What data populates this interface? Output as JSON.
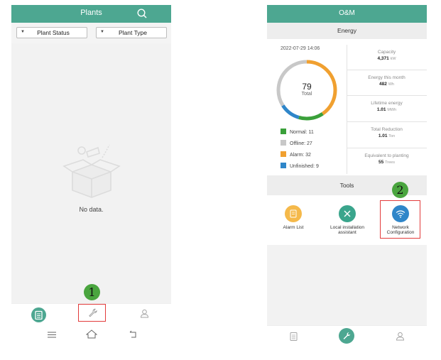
{
  "left_screen": {
    "header": {
      "title": "Plants"
    },
    "filters": {
      "plant_status": "Plant Status",
      "plant_type": "Plant Type"
    },
    "empty_state": {
      "message": "No data."
    },
    "marker": "1"
  },
  "right_screen": {
    "header": {
      "title": "O&M"
    },
    "energy": {
      "section_title": "Energy",
      "timestamp": "2022-07-29 14:06",
      "total_value": "79",
      "total_label": "Total",
      "legend": [
        {
          "label": "Normal: 11",
          "color": "#3aa03a"
        },
        {
          "label": "Offline: 27",
          "color": "#c8c8c8"
        },
        {
          "label": "Alarm: 32",
          "color": "#f0a030"
        },
        {
          "label": "Unfinished: 9",
          "color": "#2f86c9"
        }
      ],
      "stats": [
        {
          "label": "Capacity",
          "value": "4,371",
          "unit": "kW"
        },
        {
          "label": "Energy this month",
          "value": "482",
          "unit": "Wh"
        },
        {
          "label": "Lifetime energy",
          "value": "1.01",
          "unit": "MWh"
        },
        {
          "label": "Total Reduction",
          "value": "1.01",
          "unit": "Ton"
        },
        {
          "label": "Equivalent to planting",
          "value": "55",
          "unit": "Trees"
        }
      ]
    },
    "tools": {
      "section_title": "Tools",
      "items": [
        {
          "label": "Alarm List",
          "color": "#f5b94a"
        },
        {
          "label": "Local installation assistant",
          "color": "#3aa58c"
        },
        {
          "label": "Network Configuration",
          "color": "#2f86c9"
        }
      ]
    },
    "marker": "2"
  },
  "colors": {
    "brand": "#4da791",
    "highlight": "#e23b3b",
    "marker": "#4aa53f"
  }
}
